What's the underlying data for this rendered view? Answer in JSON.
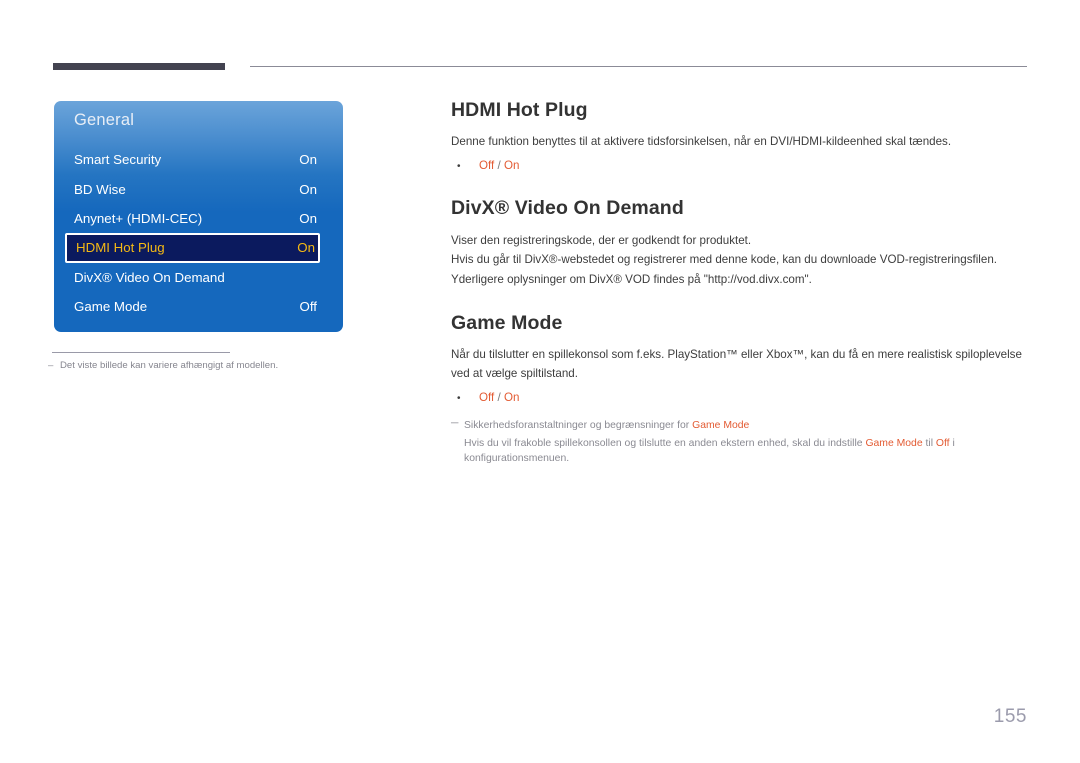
{
  "header": {
    "rule_left_color": "#434350",
    "rule_right_color": "#8b8b97"
  },
  "osd": {
    "title": "General",
    "rows": [
      {
        "label": "Smart Security",
        "value": "On",
        "selected": false
      },
      {
        "label": "BD Wise",
        "value": "On",
        "selected": false
      },
      {
        "label": "Anynet+ (HDMI-CEC)",
        "value": "On",
        "selected": false
      },
      {
        "label": "HDMI Hot Plug",
        "value": "On",
        "selected": true
      },
      {
        "label": "DivX® Video On Demand",
        "value": "",
        "selected": false
      },
      {
        "label": "Game Mode",
        "value": "Off",
        "selected": false
      }
    ],
    "selected_text_color": "#f5b914",
    "selected_bg_color": "#0b1a5e",
    "panel_blue": "#1568bd"
  },
  "panel_note": {
    "dash": "–",
    "text": "Det viste billede kan variere afhængigt af modellen."
  },
  "content": {
    "sections": [
      {
        "heading": "HDMI Hot Plug",
        "paragraphs": [
          "Denne funktion benyttes til at aktivere tidsforsinkelsen, når en DVI/HDMI-kildeenhed skal tændes."
        ],
        "bullet": {
          "dot": "•",
          "option_off": "Off",
          "separator": " / ",
          "option_on": "On"
        }
      },
      {
        "heading": "DivX® Video On Demand",
        "paragraphs": [
          "Viser den registreringskode, der er godkendt for produktet.",
          "Hvis du går til DivX®-webstedet og registrerer med denne kode, kan du downloade VOD-registreringsfilen.",
          "Yderligere oplysninger om DivX® VOD findes på \"http://vod.divx.com\"."
        ],
        "bullet": null
      },
      {
        "heading": "Game Mode",
        "paragraphs": [
          "Når du tilslutter en spillekonsol som f.eks. PlayStation™ eller Xbox™, kan du få en mere realistisk spiloplevelse ved at vælge spiltilstand."
        ],
        "bullet": {
          "dot": "•",
          "option_off": "Off",
          "separator": " / ",
          "option_on": "On"
        },
        "caution": {
          "dash": "─",
          "title_pre": "Sikkerhedsforanstaltninger og begrænsninger for ",
          "title_hl": "Game Mode",
          "body_pre": "Hvis du vil frakoble spillekonsollen og tilslutte en anden ekstern enhed, skal du indstille ",
          "body_hl1": "Game Mode",
          "body_mid": " til ",
          "body_hl2": "Off",
          "body_post": " i konfigurationsmenuen."
        }
      }
    ],
    "accent_color": "#e35b33",
    "heading_color": "#333333",
    "body_color": "#3d3d3d"
  },
  "page_number": "155"
}
